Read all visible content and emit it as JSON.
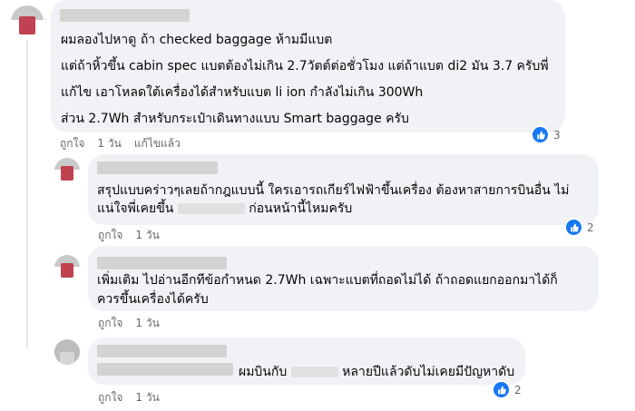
{
  "comments": [
    {
      "lines": [
        "ผมลองไปหาดู ถ้า checked baggage ห้ามมีแบต",
        "แต่ถ้าหิ้วขึ้น cabin spec แบตต้องไม่เกิน 2.7วัตต์ต่อชั่วโมง แต่ถ้าแบต di2 มัน 3.7 ครับพี่",
        "แก้ไข เอาโหลดใต้เครื่องได้สำหรับแบต li ion กำลังไม่เกิน 300Wh",
        "ส่วน 2.7Wh สำหรับกระเป๋าเดินทางแบบ Smart baggage ครับ"
      ],
      "like_label": "ถูกใจ",
      "time": "1 วัน",
      "edited_label": "แก้ไขแล้ว",
      "reaction_count": "3"
    },
    {
      "line1": "สรุปแบบคร่าวๆเลยถ้ากฎแบบนี้ ใครเอารถเกียร์ไฟฟ้าขึ้นเครื่อง ต้องหาสายการบินอื่น ไม่",
      "line2_pre": "แน่ใจพี่เคยขึ้น",
      "line2_post": "ก่อนหน้านี้ไหมครับ",
      "like_label": "ถูกใจ",
      "time": "1 วัน",
      "reaction_count": "2"
    },
    {
      "lines": [
        "เพิ่มเติม ไปอ่านอีกทีข้อกำหนด 2.7Wh เฉพาะแบตที่ถอดไม่ได้ ถ้าถอดแยกออกมาได้ก็",
        "ควรขึ้นเครื่องได้ครับ"
      ],
      "like_label": "ถูกใจ",
      "time": "1 วัน"
    },
    {
      "text_pre": "ผมบินกับ",
      "text_post": "หลายปีแล้วดับไม่เคยมีปัญหาดับ",
      "like_label": "ถูกใจ",
      "time": "1 วัน",
      "reaction_count": "2"
    }
  ],
  "colors": {
    "bubble": "#f0f2f5",
    "like_blue": "#1877f2",
    "meta_text": "#65676b"
  },
  "icons": {
    "reaction": "like-thumb-icon"
  }
}
